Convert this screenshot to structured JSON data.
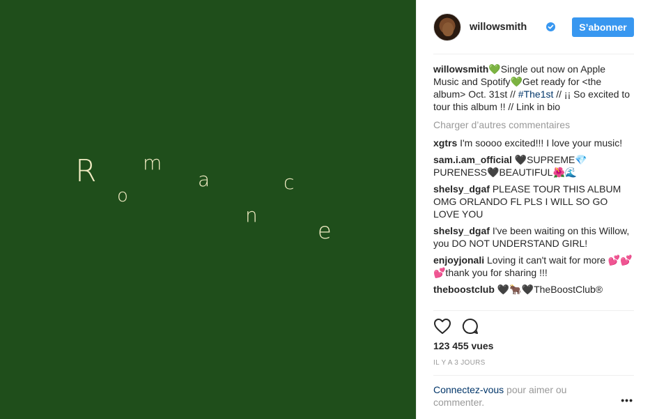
{
  "media": {
    "background_color": "#1f4e1b",
    "text_color": "#f2ecc4",
    "letters": [
      "R",
      "o",
      "m",
      "a",
      "n",
      "c",
      "e"
    ]
  },
  "header": {
    "username": "willowsmith",
    "follow_label": "S’abonner"
  },
  "caption": {
    "username": "willowsmith",
    "text_1": "💚Single out now on Apple Music and Spotify💚Get ready for <the album> Oct. 31st // ",
    "hashtag": "#The1st",
    "text_2": " // ¡¡ So excited to tour this album !! // Link in bio"
  },
  "load_more_label": "Charger d’autres commentaires",
  "comments": [
    {
      "user": "xgtrs",
      "text": " I'm soooo excited!!! I love your music!"
    },
    {
      "user": "sam.i.am_official",
      "text": " 🖤SUPREME💎 PURENESS🖤BEAUTIFUL🌺🌊"
    },
    {
      "user": "shelsy_dgaf",
      "text": " PLEASE TOUR THIS ALBUM OMG ORLANDO FL PLS I WILL SO GO LOVE YOU"
    },
    {
      "user": "shelsy_dgaf",
      "text": " I've been waiting on this Willow, you DO NOT UNDERSTAND GIRL!"
    },
    {
      "user": "enjoyjonali",
      "text": " Loving it can't wait for more 💕💕💕thank you for sharing !!!"
    },
    {
      "user": "theboostclub",
      "text": " 🖤🐂🖤TheBoostClub®"
    }
  ],
  "stats": {
    "views": "123 455 vues",
    "time": "IL Y A 3 JOURS"
  },
  "login": {
    "link": "Connectez-vous",
    "text": " pour aimer ou commenter."
  },
  "colors": {
    "accent": "#3897f0",
    "link": "#003569"
  }
}
